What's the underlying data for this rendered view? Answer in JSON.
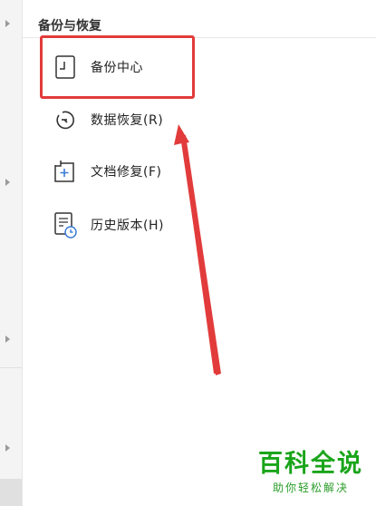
{
  "section": {
    "title": "备份与恢复"
  },
  "menu": {
    "items": [
      {
        "label": "备份中心",
        "icon": "backup-center-icon"
      },
      {
        "label": "数据恢复(R)",
        "icon": "restore-icon"
      },
      {
        "label": "文档修复(F)",
        "icon": "document-repair-icon"
      },
      {
        "label": "历史版本(H)",
        "icon": "history-version-icon"
      }
    ]
  },
  "annotation": {
    "highlight_color": "#e23b3b",
    "arrow_color": "#e23b3b"
  },
  "watermark": {
    "title": "百科全说",
    "subtitle": "助你轻松解决",
    "color": "#1aa51a"
  }
}
